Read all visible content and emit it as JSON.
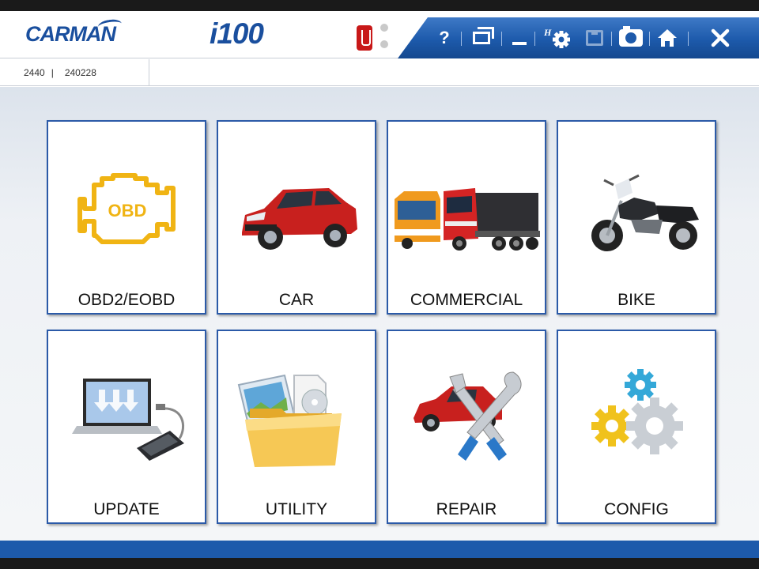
{
  "header": {
    "brand": "CARMAN",
    "model": "i100"
  },
  "toolbar": {
    "help": "?",
    "settings_prefix": "H"
  },
  "info": {
    "left": "2440",
    "separator": "|",
    "right": "240228"
  },
  "tiles": [
    {
      "label": "OBD2/EOBD",
      "obd_text": "OBD"
    },
    {
      "label": "CAR"
    },
    {
      "label": "COMMERCIAL"
    },
    {
      "label": "BIKE"
    },
    {
      "label": "UPDATE"
    },
    {
      "label": "UTILITY"
    },
    {
      "label": "REPAIR"
    },
    {
      "label": "CONFIG"
    }
  ],
  "colors": {
    "brand_blue": "#1a4f9e",
    "toolbar_blue": "#1d5aab",
    "tile_border": "#2b5aa8",
    "obd_yellow": "#f0b414",
    "car_red": "#c8201e"
  }
}
